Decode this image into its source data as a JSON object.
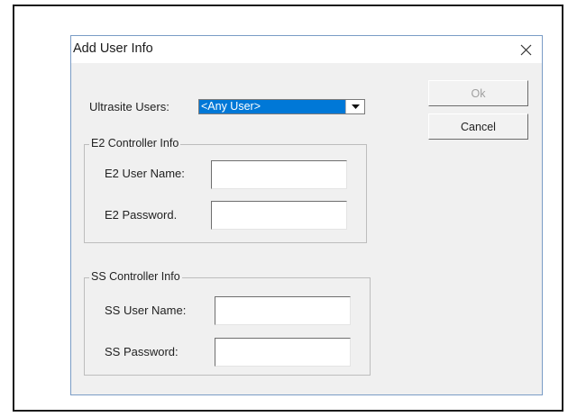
{
  "dialog": {
    "title": "Add User Info",
    "close_glyph": "×",
    "ultrasite_users_label": "Ultrasite Users:",
    "ultrasite_users_value": "<Any User>",
    "ok_label": "Ok",
    "cancel_label": "Cancel",
    "e2_group": {
      "legend": "E2 Controller Info",
      "username_label": "E2 User Name:",
      "password_label": "E2 Password.",
      "username_value": "",
      "password_value": ""
    },
    "ss_group": {
      "legend": "SS Controller Info",
      "username_label": "SS User Name:",
      "password_label": "SS Password:",
      "username_value": "",
      "password_value": ""
    }
  },
  "icons": {
    "close": "close-icon",
    "dropdown": "chevron-down-icon"
  },
  "colors": {
    "selection": "#0078d7",
    "dialog_bg": "#f0f0f0",
    "border": "#7a9cc6"
  }
}
